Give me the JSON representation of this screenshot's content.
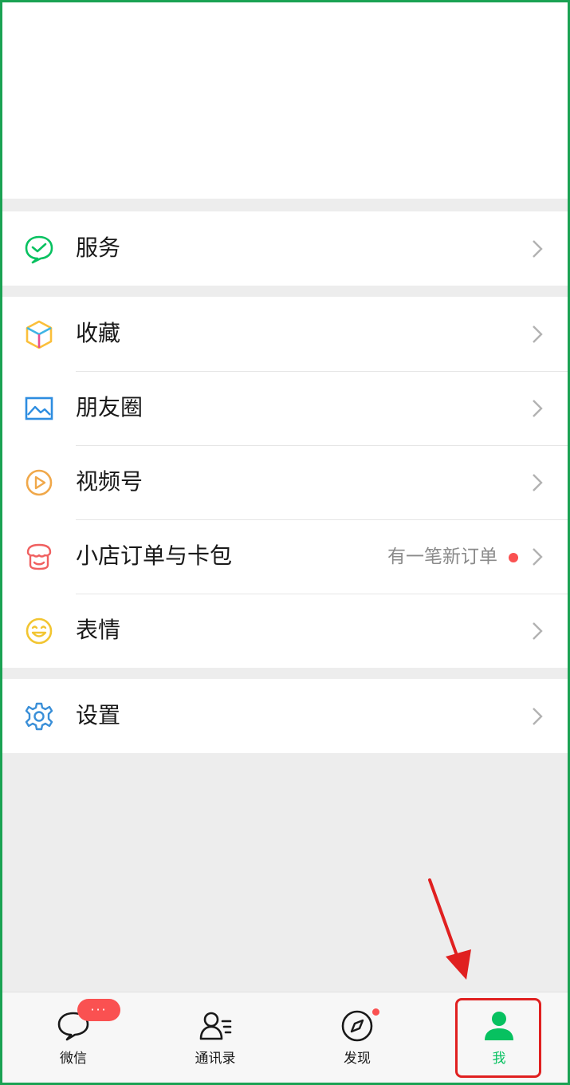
{
  "menu": {
    "service": {
      "label": "服务",
      "icon": "service-icon"
    },
    "collect": {
      "label": "收藏",
      "icon": "favorites-icon"
    },
    "moments": {
      "label": "朋友圈",
      "icon": "moments-icon"
    },
    "channels": {
      "label": "视频号",
      "icon": "channels-icon"
    },
    "orders": {
      "label": "小店订单与卡包",
      "hint": "有一笔新订单",
      "icon": "shop-icon"
    },
    "stickers": {
      "label": "表情",
      "icon": "stickers-icon"
    },
    "settings": {
      "label": "设置",
      "icon": "gear-icon"
    }
  },
  "tabbar": {
    "chats": {
      "label": "微信",
      "badge": "···"
    },
    "contacts": {
      "label": "通讯录"
    },
    "discover": {
      "label": "发现"
    },
    "me": {
      "label": "我"
    }
  },
  "colors": {
    "accent": "#07c160",
    "badge": "#fa5151",
    "annotation": "#e02020",
    "frame": "#1aa253"
  }
}
